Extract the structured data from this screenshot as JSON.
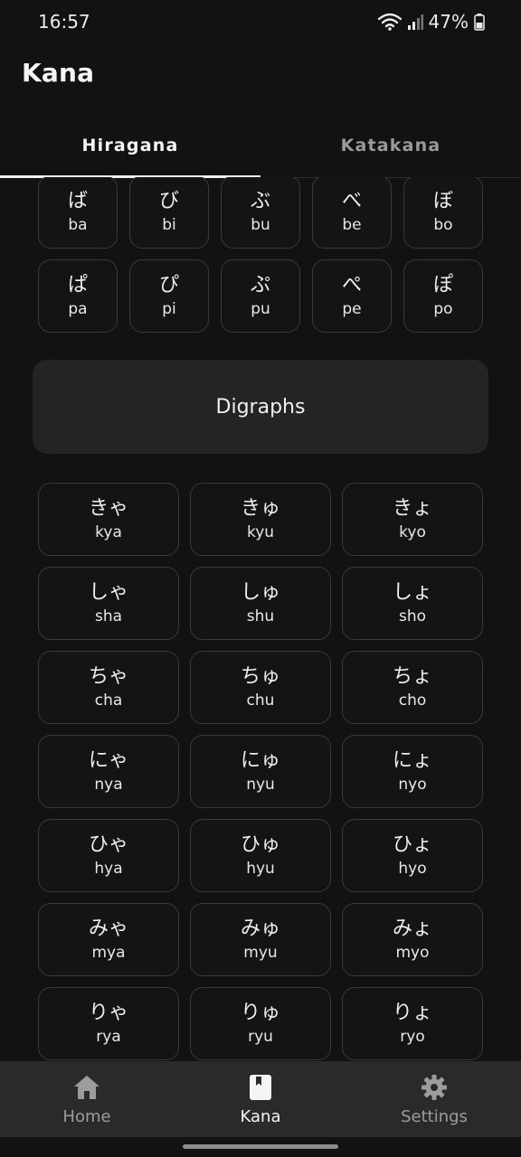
{
  "status": {
    "time": "16:57",
    "battery": "47%"
  },
  "app": {
    "title": "Kana"
  },
  "tabs": [
    {
      "label": "Hiragana",
      "active": true
    },
    {
      "label": "Katakana",
      "active": false
    }
  ],
  "dakuten_rows": [
    [
      {
        "kana": "ば",
        "romaji": "ba"
      },
      {
        "kana": "び",
        "romaji": "bi"
      },
      {
        "kana": "ぶ",
        "romaji": "bu"
      },
      {
        "kana": "べ",
        "romaji": "be"
      },
      {
        "kana": "ぼ",
        "romaji": "bo"
      }
    ],
    [
      {
        "kana": "ぱ",
        "romaji": "pa"
      },
      {
        "kana": "ぴ",
        "romaji": "pi"
      },
      {
        "kana": "ぷ",
        "romaji": "pu"
      },
      {
        "kana": "ぺ",
        "romaji": "pe"
      },
      {
        "kana": "ぽ",
        "romaji": "po"
      }
    ]
  ],
  "digraphs": {
    "title": "Digraphs",
    "items": [
      {
        "kana": "きゃ",
        "romaji": "kya"
      },
      {
        "kana": "きゅ",
        "romaji": "kyu"
      },
      {
        "kana": "きょ",
        "romaji": "kyo"
      },
      {
        "kana": "しゃ",
        "romaji": "sha"
      },
      {
        "kana": "しゅ",
        "romaji": "shu"
      },
      {
        "kana": "しょ",
        "romaji": "sho"
      },
      {
        "kana": "ちゃ",
        "romaji": "cha"
      },
      {
        "kana": "ちゅ",
        "romaji": "chu"
      },
      {
        "kana": "ちょ",
        "romaji": "cho"
      },
      {
        "kana": "にゃ",
        "romaji": "nya"
      },
      {
        "kana": "にゅ",
        "romaji": "nyu"
      },
      {
        "kana": "にょ",
        "romaji": "nyo"
      },
      {
        "kana": "ひゃ",
        "romaji": "hya"
      },
      {
        "kana": "ひゅ",
        "romaji": "hyu"
      },
      {
        "kana": "ひょ",
        "romaji": "hyo"
      },
      {
        "kana": "みゃ",
        "romaji": "mya"
      },
      {
        "kana": "みゅ",
        "romaji": "myu"
      },
      {
        "kana": "みょ",
        "romaji": "myo"
      },
      {
        "kana": "りゃ",
        "romaji": "rya"
      },
      {
        "kana": "りゅ",
        "romaji": "ryu"
      },
      {
        "kana": "りょ",
        "romaji": "ryo"
      }
    ]
  },
  "bottom_nav": [
    {
      "label": "Home",
      "icon": "home-icon",
      "active": false
    },
    {
      "label": "Kana",
      "icon": "book-icon",
      "active": true
    },
    {
      "label": "Settings",
      "icon": "gear-icon",
      "active": false
    }
  ],
  "colors": {
    "background": "#121212",
    "card_border": "#3a3a3a",
    "section_header": "#242424",
    "nav_background": "#2a2a2a"
  }
}
